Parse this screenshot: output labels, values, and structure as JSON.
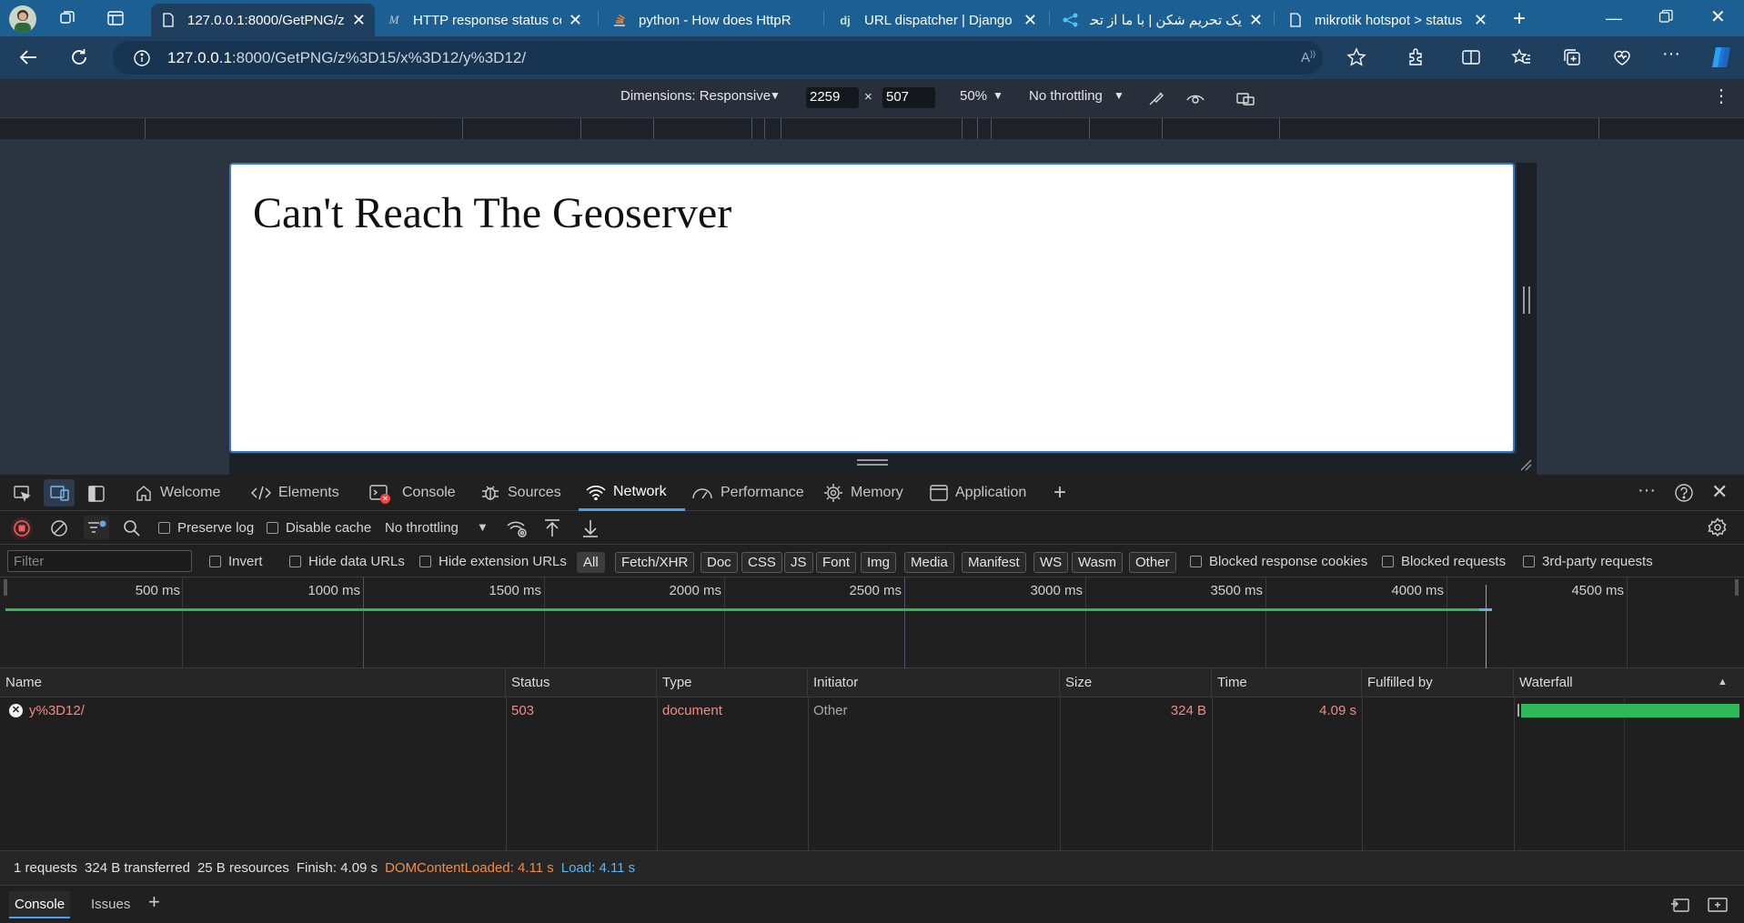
{
  "browser": {
    "tabs": [
      {
        "title": "127.0.0.1:8000/GetPNG/z",
        "icon": "document-icon",
        "active": true
      },
      {
        "title": "HTTP response status coc",
        "icon": "mdn-icon"
      },
      {
        "title": "python - How does HttpR",
        "icon": "stackoverflow-icon"
      },
      {
        "title": "URL dispatcher | Django d",
        "icon": "django-icon",
        "icon_text": "dj"
      },
      {
        "title": "یک تحریم شکن | با ما از تحر",
        "icon": "share-icon"
      },
      {
        "title": "mikrotik hotspot > status",
        "icon": "document-icon"
      }
    ],
    "url_host": "127.0.0.1",
    "url_path": ":8000/GetPNG/z%3D15/x%3D12/y%3D12/"
  },
  "device_toolbar": {
    "dimensions_label": "Dimensions: Responsive",
    "width": "2259",
    "times": "×",
    "height": "507",
    "zoom": "50%",
    "throttling": "No throttling"
  },
  "page": {
    "heading": "Can't Reach The Geoserver"
  },
  "devtools": {
    "tabs": [
      {
        "label": "Welcome",
        "icon": "home-icon"
      },
      {
        "label": "Elements",
        "icon": "code-icon"
      },
      {
        "label": "Console",
        "icon": "console-icon"
      },
      {
        "label": "Sources",
        "icon": "bug-icon"
      },
      {
        "label": "Network",
        "icon": "wifi-icon",
        "active": true
      },
      {
        "label": "Performance",
        "icon": "gauge-icon"
      },
      {
        "label": "Memory",
        "icon": "chip-icon"
      },
      {
        "label": "Application",
        "icon": "window-icon"
      }
    ],
    "network_toolbar": {
      "preserve_log": "Preserve log",
      "disable_cache": "Disable cache",
      "throttling": "No throttling"
    },
    "filter": {
      "placeholder": "Filter",
      "invert": "Invert",
      "hide_data_urls": "Hide data URLs",
      "hide_extension_urls": "Hide extension URLs",
      "types": [
        "All",
        "Fetch/XHR",
        "Doc",
        "CSS",
        "JS",
        "Font",
        "Img",
        "Media",
        "Manifest",
        "WS",
        "Wasm",
        "Other"
      ],
      "blocked_response_cookies": "Blocked response cookies",
      "blocked_requests": "Blocked requests",
      "third_party": "3rd-party requests"
    },
    "timeline_labels": [
      "500 ms",
      "1000 ms",
      "1500 ms",
      "2000 ms",
      "2500 ms",
      "3000 ms",
      "3500 ms",
      "4000 ms",
      "4500 ms"
    ],
    "table": {
      "columns": [
        "Name",
        "Status",
        "Type",
        "Initiator",
        "Size",
        "Time",
        "Fulfilled by",
        "Waterfall"
      ],
      "rows": [
        {
          "name": "y%3D12/",
          "status": "503",
          "type": "document",
          "initiator": "Other",
          "size": "324 B",
          "time": "4.09 s",
          "fulfilled_by": ""
        }
      ]
    },
    "summary": {
      "requests": "1 requests",
      "transferred": "324 B transferred",
      "resources": "25 B resources",
      "finish": "Finish: 4.09 s",
      "dom_content_loaded": "DOMContentLoaded: 4.11 s",
      "load": "Load: 4.11 s"
    },
    "drawer_tabs": [
      "Console",
      "Issues"
    ]
  },
  "colors": {
    "tabbar": "#1c5f93",
    "accent": "#4ca2f0",
    "error_text": "#f28b82",
    "waterfall_bar": "#2fb85a",
    "dcl": "#f28b45",
    "load": "#5fb3ec"
  }
}
